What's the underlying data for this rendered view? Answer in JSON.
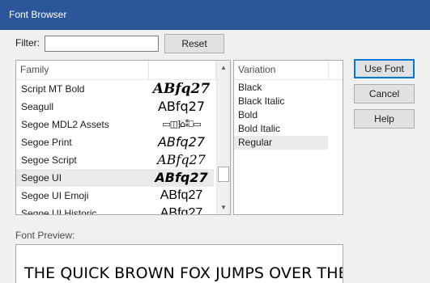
{
  "window": {
    "title": "Font Browser"
  },
  "filter": {
    "label": "Filter:",
    "value": ""
  },
  "buttons": {
    "reset": "Reset",
    "use_font": "Use Font",
    "cancel": "Cancel",
    "help": "Help"
  },
  "family_list": {
    "headers": [
      "Family",
      ""
    ],
    "rows": [
      {
        "name": "Script MT Bold",
        "sample": "ABfq27",
        "selected": false
      },
      {
        "name": "Seagull",
        "sample": "ABfq27",
        "selected": false
      },
      {
        "name": "Segoe MDL2 Assets",
        "sample": "▭◫⁆⌂⁑⎕▭",
        "selected": false
      },
      {
        "name": "Segoe Print",
        "sample": "ABfq27",
        "selected": false
      },
      {
        "name": "Segoe Script",
        "sample": "ABfq27",
        "selected": false
      },
      {
        "name": "Segoe UI",
        "sample": "ABfq27",
        "selected": true
      },
      {
        "name": "Segoe UI Emoji",
        "sample": "ABfq27",
        "selected": false
      },
      {
        "name": "Segoe UI Historic",
        "sample": "ABfq27",
        "selected": false
      }
    ],
    "scrollbar": {
      "up_icon": "▲",
      "down_icon": "▼"
    }
  },
  "variation_list": {
    "header": "Variation",
    "items": [
      {
        "label": "Black",
        "selected": false
      },
      {
        "label": "Black Italic",
        "selected": false
      },
      {
        "label": "Bold",
        "selected": false
      },
      {
        "label": "Bold Italic",
        "selected": false
      },
      {
        "label": "Regular",
        "selected": true
      }
    ]
  },
  "preview": {
    "label": "Font Preview:",
    "text": "THE QUICK BROWN FOX JUMPS OVER THE"
  }
}
